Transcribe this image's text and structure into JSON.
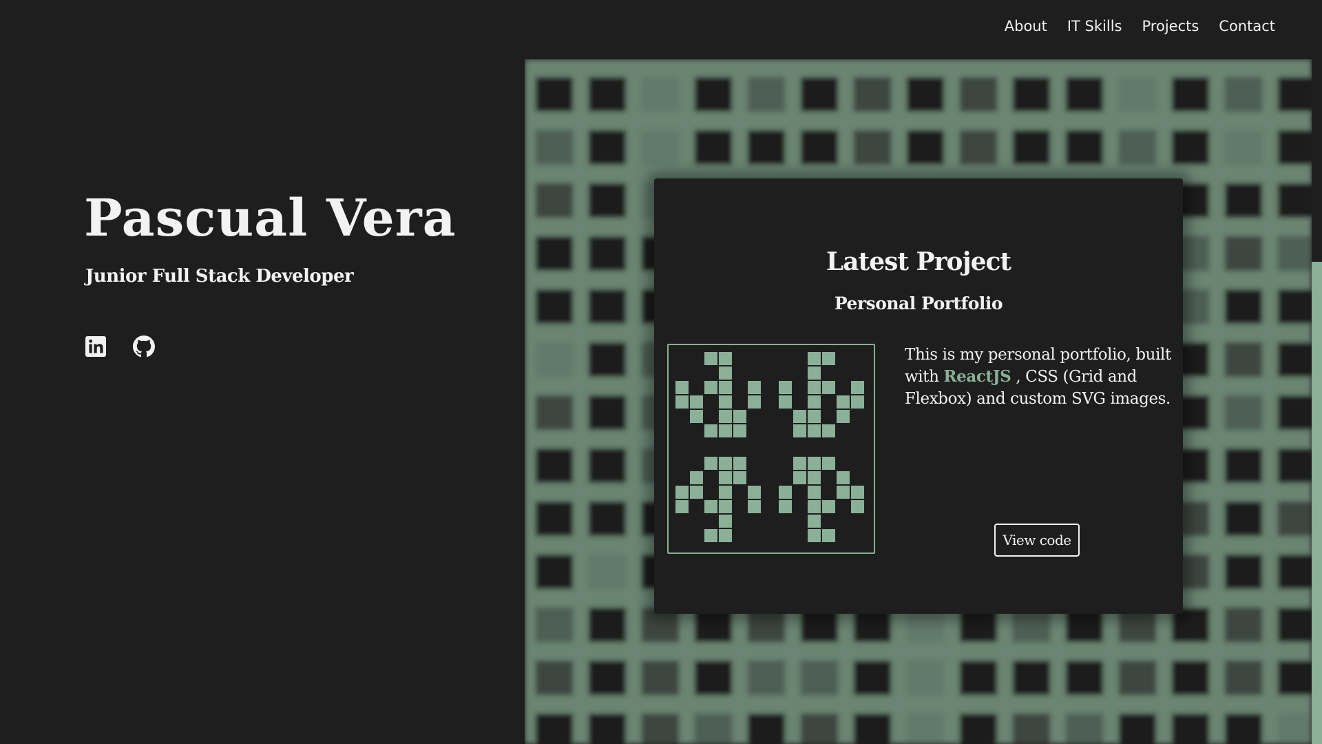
{
  "nav": {
    "items": [
      "About",
      "IT Skills",
      "Projects",
      "Contact"
    ]
  },
  "hero": {
    "name": "Pascual Vera",
    "title": "Junior Full Stack Developer",
    "socials": [
      "linkedin-icon",
      "github-icon"
    ]
  },
  "project": {
    "heading": "Latest Project",
    "name": "Personal Portfolio",
    "description_before": "This is my personal portfolio, built with ",
    "highlight": "ReactJS",
    "description_after": " , CSS (Grid and Flexbox) and custom SVG images.",
    "button_label": "View code"
  },
  "colors": {
    "background": "#1e1e1e",
    "accent": "#8ab097",
    "text": "#f2f2f2"
  }
}
